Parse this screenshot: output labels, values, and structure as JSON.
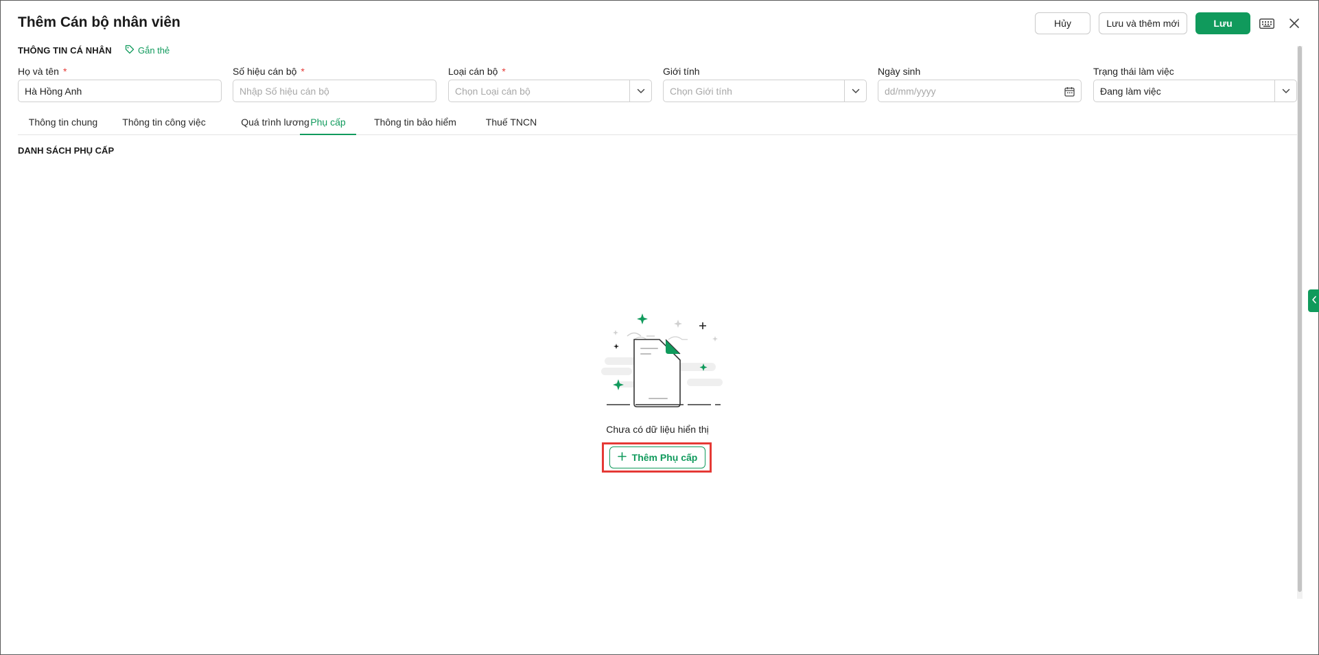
{
  "header": {
    "title": "Thêm Cán bộ nhân viên",
    "cancel_label": "Hủy",
    "save_new_label": "Lưu và thêm mới",
    "save_label": "Lưu"
  },
  "section": {
    "title": "THÔNG TIN CÁ NHÂN",
    "tag_label": "Gắn thẻ"
  },
  "fields": {
    "name": {
      "label": "Họ và tên",
      "required": "*",
      "value": "Hà Hồng Anh"
    },
    "code": {
      "label": "Số hiệu cán bộ",
      "required": "*",
      "placeholder": "Nhập Số hiệu cán bộ"
    },
    "type": {
      "label": "Loại cán bộ",
      "required": "*",
      "placeholder": "Chọn Loại cán bộ"
    },
    "gender": {
      "label": "Giới tính",
      "placeholder": "Chọn Giới tính"
    },
    "dob": {
      "label": "Ngày sinh",
      "placeholder": "dd/mm/yyyy"
    },
    "status": {
      "label": "Trạng thái làm việc",
      "value": "Đang làm việc"
    }
  },
  "tabs": [
    {
      "label": "Thông tin chung"
    },
    {
      "label": "Thông tin công việc"
    },
    {
      "label": "Quá trình lương"
    },
    {
      "label": "Phụ cấp",
      "active": true
    },
    {
      "label": "Thông tin bảo hiểm"
    },
    {
      "label": "Thuế TNCN"
    }
  ],
  "list": {
    "title": "DANH SÁCH PHỤ CẤP",
    "empty_text": "Chưa có dữ liệu hiển thị",
    "add_label": "Thêm Phụ cấp"
  },
  "colors": {
    "accent": "#109a5c",
    "required": "#e53935",
    "highlight": "#e53935"
  },
  "icons": {
    "tag": "tag-icon",
    "keyboard": "keyboard-icon",
    "close": "close-icon",
    "chevron": "chevron-down-icon",
    "calendar": "calendar-icon",
    "plus": "plus-icon",
    "side": "chevron-left-icon"
  }
}
